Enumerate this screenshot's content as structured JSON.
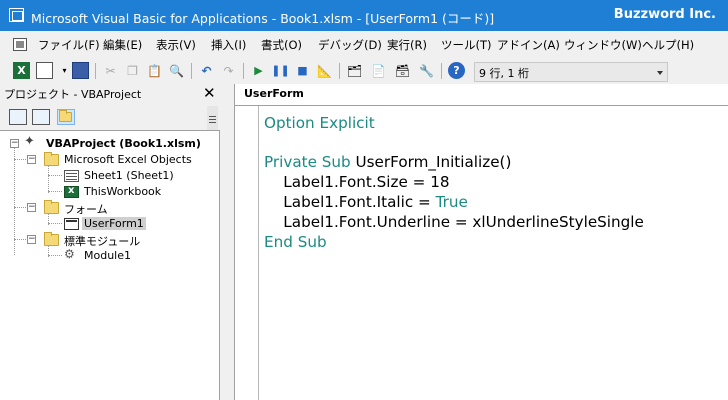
{
  "titlebar": {
    "title": "Microsoft Visual Basic for Applications - Book1.xlsm - [UserForm1 (コード)]",
    "brand": "Buzzword Inc."
  },
  "menubar": {
    "items": [
      {
        "label": "ファイル(F)"
      },
      {
        "label": "編集(E)"
      },
      {
        "label": "表示(V)"
      },
      {
        "label": "挿入(I)"
      },
      {
        "label": "書式(O)"
      },
      {
        "label": "デバッグ(D)"
      },
      {
        "label": "実行(R)"
      },
      {
        "label": "ツール(T)"
      },
      {
        "label": "アドイン(A)"
      },
      {
        "label": "ウィンドウ(W)"
      },
      {
        "label": "ヘルプ(H)"
      }
    ]
  },
  "toolbar": {
    "position": "9 行, 1 桁",
    "icons": [
      "excel-icon",
      "insert-userform-icon",
      "save-icon",
      "cut-icon",
      "copy-icon",
      "paste-icon",
      "find-icon",
      "undo-icon",
      "redo-icon",
      "run-icon",
      "break-icon",
      "reset-icon",
      "design-mode-icon",
      "project-explorer-icon",
      "properties-icon",
      "object-browser-icon",
      "toolbox-icon",
      "help-icon"
    ]
  },
  "project": {
    "header": "プロジェクト - VBAProject",
    "tree": {
      "root": "VBAProject (Book1.xlsm)",
      "excel_objects_folder": "Microsoft Excel Objects",
      "sheet1": "Sheet1 (Sheet1)",
      "this_workbook": "ThisWorkbook",
      "forms_folder": "フォーム",
      "userform1": "UserForm1",
      "modules_folder": "標準モジュール",
      "module1": "Module1"
    }
  },
  "code": {
    "object": "UserForm",
    "lines": {
      "l1_kw": "Option Explicit",
      "l3_kw": "Private Sub",
      "l3_rest": " UserForm_Initialize()",
      "l4": "    Label1.Font.Size = 18",
      "l5_a": "    Label1.Font.Italic = ",
      "l5_kw": "True",
      "l6": "    Label1.Font.Underline = xlUnderlineStyleSingle",
      "l7_kw": "End Sub"
    }
  },
  "colors": {
    "titlebar": "#1f7fd4",
    "keyword": "#1b8a83",
    "chrome": "#f0f0f0"
  }
}
